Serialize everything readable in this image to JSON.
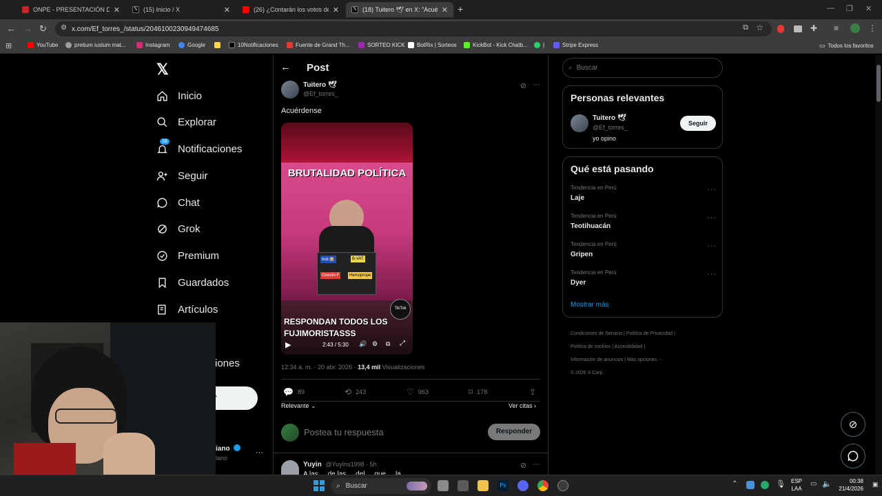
{
  "browser": {
    "tabs": [
      {
        "title": "ONPE - PRESENTACIÓN DE RES",
        "favicon_color": "#c62828"
      },
      {
        "title": "(15) Inicio / X",
        "favicon_color": "#000000"
      },
      {
        "title": "(26) ¿Contarán los votos de act",
        "favicon_color": "#ff0000"
      },
      {
        "title": "(18) Tuitero 🕊 en X: \"Acuérden",
        "favicon_color": "#000000"
      }
    ],
    "url": "x.com/Ef_torres_/status/2046100230949474685",
    "bookmarks": [
      {
        "label": "YouTube",
        "color": "#ff0000"
      },
      {
        "label": "pretium iustum mat...",
        "color": "#9e9e9e"
      },
      {
        "label": "Instagram",
        "color": "#d62976"
      },
      {
        "label": "Google",
        "color": "#4285f4"
      },
      {
        "label": "",
        "color": "#ffd54f"
      },
      {
        "label": "10Notificaciones",
        "color": "#000000"
      },
      {
        "label": "Fuente de Grand Th...",
        "color": "#e53935"
      },
      {
        "label": "SORTEO KICK",
        "color": "#9c27b0"
      },
      {
        "label": "BotRix | Sorteos",
        "color": "#ffffff"
      },
      {
        "label": "KickBot - Kick Chatb...",
        "color": "#53fc18"
      },
      {
        "label": "|",
        "color": "#25d366"
      },
      {
        "label": "Stripe Express",
        "color": "#635bff"
      }
    ],
    "all_bookmarks": "Todos los favoritos"
  },
  "sidebar": {
    "logo": "X",
    "items": [
      {
        "label": "Inicio",
        "icon": "home-icon"
      },
      {
        "label": "Explorar",
        "icon": "search-icon"
      },
      {
        "label": "Notificaciones",
        "icon": "bell-icon",
        "badge": "18"
      },
      {
        "label": "Seguir",
        "icon": "follow-icon"
      },
      {
        "label": "Chat",
        "icon": "chat-icon"
      },
      {
        "label": "Grok",
        "icon": "grok-icon"
      },
      {
        "label": "Premium",
        "icon": "premium-icon"
      },
      {
        "label": "Guardados",
        "icon": "bookmark-icon"
      },
      {
        "label": "Artículos",
        "icon": "articles-icon"
      },
      {
        "label": "iones",
        "icon": ""
      }
    ],
    "post_button": "r",
    "account_name": "iano",
    "account_handle": "lano"
  },
  "post": {
    "header": "Post",
    "author_name": "Tuitero 🕊",
    "author_handle": "@Ef_torres_",
    "text": "Acuérdense",
    "video": {
      "title_text": "BRUTALIDAD POLÍTICA",
      "caption": "RESPONDAN TODOS LOS FUJIMORISTASSS",
      "time": "2:43 / 5:30",
      "sponsor_labels": [
        "boti 🎰",
        "B-VAT",
        "Oremin-F",
        "Hemoprope"
      ],
      "badge": "TikTok"
    },
    "timestamp": "12:34 a. m. · 20 abr. 2026 ·",
    "views_count": "13,4 mil",
    "views_label": "Visualizaciones",
    "stats": {
      "replies": "89",
      "reposts": "243",
      "likes": "963",
      "bookmarks": "178"
    },
    "relevance": "Relevante",
    "quotes": "Ver citas",
    "reply_placeholder": "Postea tu respuesta",
    "reply_button": "Responder",
    "reply_preview": {
      "name": "Yuyin",
      "handle": "@YuyIns1998 · 5h",
      "text": "A las ... de las ... del ... que ... la ... "
    }
  },
  "right": {
    "search_placeholder": "Buscar",
    "relevant_title": "Personas relevantes",
    "relevant_user": {
      "name": "Tuitero 🕊",
      "handle": "@Ef_torres_",
      "bio": "yo opino",
      "follow": "Seguir"
    },
    "trending_title": "Qué está pasando",
    "trends": [
      {
        "category": "Tendencia en Perú",
        "name": "Laje"
      },
      {
        "category": "Tendencia en Perú",
        "name": "Teotihuacán"
      },
      {
        "category": "Tendencia en Perú",
        "name": "Gripen"
      },
      {
        "category": "Tendencia en Perú",
        "name": "Dyer"
      }
    ],
    "show_more": "Mostrar más",
    "footer": [
      [
        "Condiciones de Servicio",
        "Política de Privacidad"
      ],
      [
        "Política de cookies",
        "Accesibilidad"
      ],
      [
        "Información de anuncios",
        "Más opciones ···"
      ],
      [
        "© 2026 X Corp."
      ]
    ]
  },
  "taskbar": {
    "search": "Buscar",
    "lang_top": "ESP",
    "lang_bottom": "LAA",
    "time": "00:38",
    "date": "21/4/2026"
  },
  "colors": {
    "accent": "#1d9bf0",
    "bg": "#000000",
    "border": "#2f3336",
    "muted": "#71767b"
  }
}
